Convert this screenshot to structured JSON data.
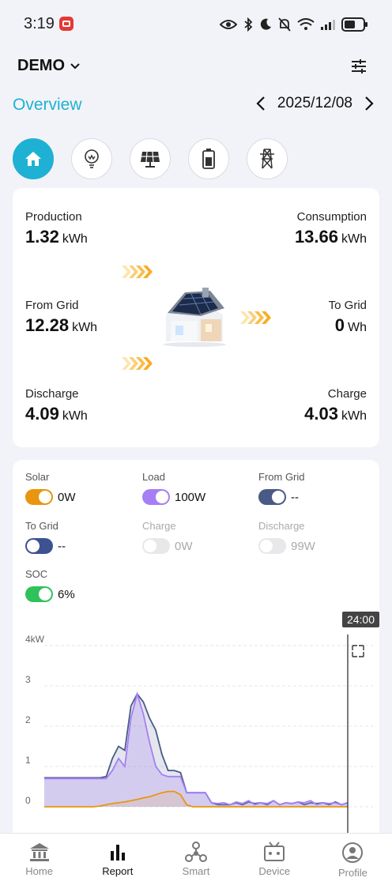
{
  "status": {
    "time": "3:19"
  },
  "header": {
    "site_name": "DEMO"
  },
  "datebar": {
    "section_title": "Overview",
    "date": "2025/12/08"
  },
  "categories": [
    {
      "name": "home",
      "icon": "home-icon",
      "active": true
    },
    {
      "name": "consumption",
      "icon": "bulb-icon",
      "active": false
    },
    {
      "name": "solar",
      "icon": "solar-panel-icon",
      "active": false
    },
    {
      "name": "battery",
      "icon": "battery-icon",
      "active": false
    },
    {
      "name": "grid",
      "icon": "power-tower-icon",
      "active": false
    }
  ],
  "flow": {
    "production": {
      "label": "Production",
      "value": "1.32",
      "unit": "kWh"
    },
    "consumption": {
      "label": "Consumption",
      "value": "13.66",
      "unit": "kWh"
    },
    "from_grid": {
      "label": "From Grid",
      "value": "12.28",
      "unit": "kWh"
    },
    "to_grid": {
      "label": "To Grid",
      "value": "0",
      "unit": "Wh"
    },
    "discharge": {
      "label": "Discharge",
      "value": "4.09",
      "unit": "kWh"
    },
    "charge": {
      "label": "Charge",
      "value": "4.03",
      "unit": "kWh"
    }
  },
  "toggles": {
    "solar": {
      "label": "Solar",
      "value": "0W",
      "color": "#e8960f",
      "on": true
    },
    "load": {
      "label": "Load",
      "value": "100W",
      "color": "#a57ff5",
      "on": true
    },
    "from_grid": {
      "label": "From Grid",
      "value": "--",
      "color": "#4a5a86",
      "on": true
    },
    "to_grid": {
      "label": "To Grid",
      "value": "--",
      "color": "#3d5290",
      "on": false
    },
    "charge": {
      "label": "Charge",
      "value": "0W",
      "color": "#e8e8ea",
      "on": false
    },
    "discharge": {
      "label": "Discharge",
      "value": "99W",
      "color": "#e8e8ea",
      "on": false
    },
    "soc": {
      "label": "SOC",
      "value": "6%",
      "color": "#2fc25b",
      "on": true
    }
  },
  "chart_data": {
    "type": "line",
    "y_unit": "kW",
    "yticks": [
      "4kW",
      "3",
      "2",
      "1",
      "0"
    ],
    "ylim": [
      0,
      4
    ],
    "time_marker": "24:00",
    "grid": true,
    "series": [
      {
        "key": "from_grid",
        "color": "#4a5a86",
        "values": [
          0.72,
          0.72,
          0.72,
          0.72,
          0.72,
          0.72,
          0.72,
          0.72,
          0.72,
          0.72,
          0.75,
          1.2,
          1.5,
          1.4,
          2.5,
          2.8,
          2.6,
          2.2,
          1.9,
          1.3,
          0.9,
          0.9,
          0.85,
          0.35,
          0.35,
          0.35,
          0.35,
          0.1,
          0.05,
          0.05,
          0.05,
          0.1,
          0.05,
          0.12,
          0.08,
          0.1,
          0.05,
          0.15,
          0.05,
          0.1,
          0.08,
          0.12,
          0.05,
          0.1,
          0.08,
          0.1,
          0.05,
          0.12,
          0.05,
          0.1
        ]
      },
      {
        "key": "load",
        "color": "#a57ff5",
        "values": [
          0.7,
          0.7,
          0.7,
          0.7,
          0.7,
          0.7,
          0.7,
          0.7,
          0.7,
          0.7,
          0.7,
          0.9,
          1.2,
          1.0,
          2.2,
          2.8,
          2.3,
          1.6,
          1.0,
          0.8,
          0.75,
          0.75,
          0.75,
          0.35,
          0.35,
          0.35,
          0.35,
          0.1,
          0.08,
          0.1,
          0.05,
          0.12,
          0.08,
          0.15,
          0.05,
          0.1,
          0.08,
          0.15,
          0.05,
          0.1,
          0.08,
          0.12,
          0.1,
          0.15,
          0.05,
          0.1,
          0.08,
          0.1,
          0.05,
          0.1
        ]
      },
      {
        "key": "solar",
        "color": "#e8960f",
        "values": [
          0,
          0,
          0,
          0,
          0,
          0,
          0,
          0,
          0,
          0.02,
          0.05,
          0.08,
          0.1,
          0.12,
          0.15,
          0.18,
          0.22,
          0.25,
          0.3,
          0.35,
          0.38,
          0.38,
          0.3,
          0.05,
          0,
          0,
          0,
          0,
          0,
          0,
          0,
          0,
          0,
          0,
          0,
          0,
          0,
          0,
          0,
          0,
          0,
          0,
          0,
          0,
          0,
          0,
          0,
          0,
          0,
          0
        ]
      }
    ]
  },
  "bottom_nav": [
    {
      "label": "Home",
      "icon": "bank-icon",
      "active": false
    },
    {
      "label": "Report",
      "icon": "bar-chart-icon",
      "active": true
    },
    {
      "label": "Smart",
      "icon": "hub-icon",
      "active": false
    },
    {
      "label": "Device",
      "icon": "device-icon",
      "active": false
    },
    {
      "label": "Profile",
      "icon": "profile-icon",
      "active": false
    }
  ]
}
